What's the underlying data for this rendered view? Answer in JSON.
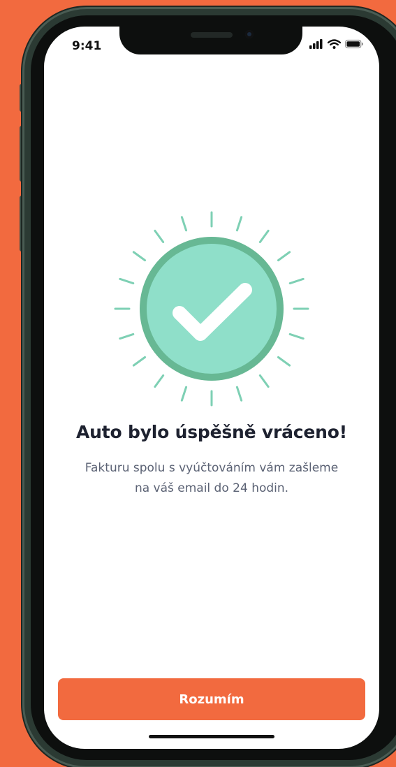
{
  "status_bar": {
    "time": "9:41",
    "icons": [
      "cellular-signal-icon",
      "wifi-icon",
      "battery-icon"
    ]
  },
  "illustration": {
    "icon": "checkmark-icon",
    "circle_color": "#8fdfc9",
    "ring_color": "#67b894",
    "ray_color": "#7ed0b4"
  },
  "content": {
    "title": "Auto bylo úspěšně vráceno!",
    "message_line1": "Fakturu spolu s vyúčtováním vám zašleme",
    "message_line2": "na váš email do 24 hodin."
  },
  "actions": {
    "confirm_label": "Rozumím",
    "accent_color": "#f26a3f"
  }
}
